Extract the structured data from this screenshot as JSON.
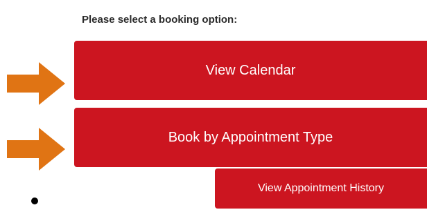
{
  "prompt": "Please select a booking option:",
  "buttons": {
    "view_calendar": "View Calendar",
    "book_by_type": "Book by Appointment Type",
    "view_history": "View Appointment History"
  },
  "icons": {
    "arrow": "right-arrow-icon",
    "bullet": "bullet-dot"
  },
  "colors": {
    "button_bg": "#cc1520",
    "button_text": "#ffffff",
    "arrow": "#e07414",
    "prompt_text": "#2a2a2a"
  }
}
